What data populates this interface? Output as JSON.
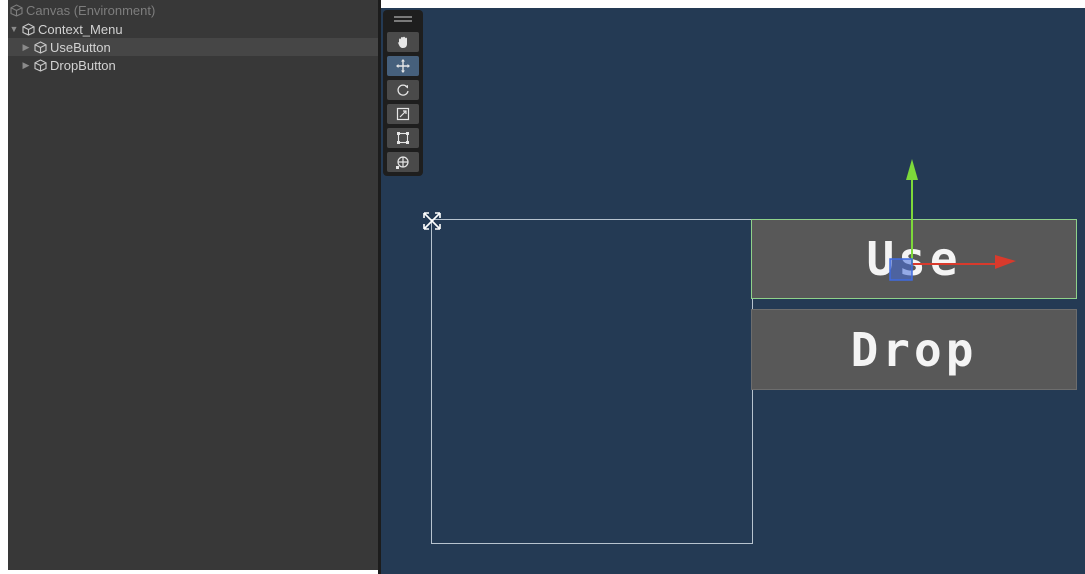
{
  "hierarchy": {
    "items": [
      {
        "label": "Canvas (Environment)",
        "expanded": true,
        "selected": false
      },
      {
        "label": "Context_Menu",
        "expanded": true,
        "selected": false
      },
      {
        "label": "UseButton",
        "expanded": false,
        "selected": true
      },
      {
        "label": "DropButton",
        "expanded": false,
        "selected": false
      }
    ]
  },
  "toolbar": {
    "tools": [
      {
        "name": "hand-tool",
        "icon": "hand-icon",
        "active": false
      },
      {
        "name": "move-tool",
        "icon": "move-icon",
        "active": true
      },
      {
        "name": "rotate-tool",
        "icon": "rotate-icon",
        "active": false
      },
      {
        "name": "scale-tool",
        "icon": "scale-icon",
        "active": false
      },
      {
        "name": "rect-tool",
        "icon": "rect-icon",
        "active": false
      },
      {
        "name": "transform-tool",
        "icon": "transform-icon",
        "active": false
      }
    ]
  },
  "scene": {
    "use_button_label": "Use",
    "drop_button_label": "Drop",
    "background_color": "#243a54",
    "button_color": "#585858",
    "selection_outline_color": "#8fd28a"
  }
}
